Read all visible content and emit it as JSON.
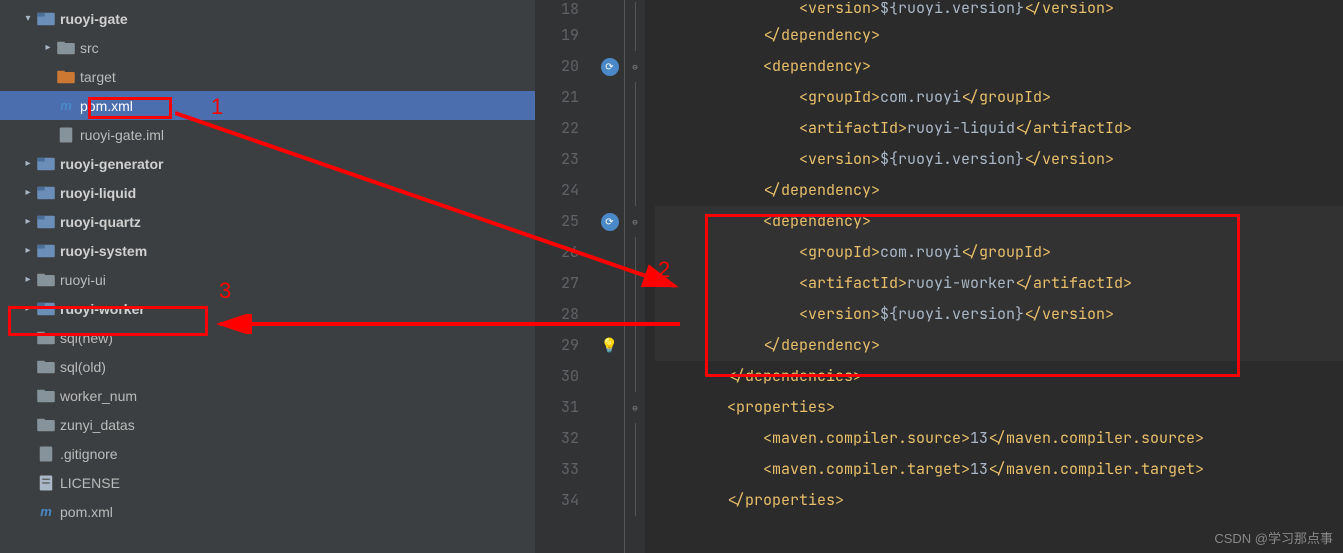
{
  "tree": {
    "items": [
      {
        "indent": 1,
        "arrow": "v",
        "icon": "module",
        "label": "ruoyi-gate",
        "bold": true
      },
      {
        "indent": 2,
        "arrow": ">",
        "icon": "folder",
        "label": "src"
      },
      {
        "indent": 2,
        "arrow": "",
        "icon": "folder-orange",
        "label": "target"
      },
      {
        "indent": 2,
        "arrow": "",
        "icon": "maven",
        "label": "pom.xml",
        "selected": true
      },
      {
        "indent": 2,
        "arrow": "",
        "icon": "file",
        "label": "ruoyi-gate.iml"
      },
      {
        "indent": 1,
        "arrow": ">",
        "icon": "module",
        "label": "ruoyi-generator",
        "bold": true
      },
      {
        "indent": 1,
        "arrow": ">",
        "icon": "module",
        "label": "ruoyi-liquid",
        "bold": true
      },
      {
        "indent": 1,
        "arrow": ">",
        "icon": "module",
        "label": "ruoyi-quartz",
        "bold": true
      },
      {
        "indent": 1,
        "arrow": ">",
        "icon": "module",
        "label": "ruoyi-system",
        "bold": true
      },
      {
        "indent": 1,
        "arrow": ">",
        "icon": "folder",
        "label": "ruoyi-ui"
      },
      {
        "indent": 1,
        "arrow": ">",
        "icon": "module",
        "label": "ruoyi-worker",
        "bold": true
      },
      {
        "indent": 1,
        "arrow": "",
        "icon": "folder",
        "label": "sql(new)"
      },
      {
        "indent": 1,
        "arrow": "",
        "icon": "folder",
        "label": "sql(old)"
      },
      {
        "indent": 1,
        "arrow": "",
        "icon": "folder",
        "label": "worker_num"
      },
      {
        "indent": 1,
        "arrow": "",
        "icon": "folder",
        "label": "zunyi_datas"
      },
      {
        "indent": 1,
        "arrow": "",
        "icon": "file",
        "label": ".gitignore"
      },
      {
        "indent": 1,
        "arrow": "",
        "icon": "file-text",
        "label": "LICENSE"
      },
      {
        "indent": 1,
        "arrow": "",
        "icon": "maven",
        "label": "pom.xml"
      }
    ]
  },
  "editor": {
    "lines": [
      {
        "num": "18",
        "ind": 4,
        "t": "closetag",
        "content": "version",
        "suffix": ">${ruoyi.version}</version>"
      },
      {
        "num": "19",
        "ind": 3,
        "t": "closetag",
        "content": "dependency"
      },
      {
        "num": "20",
        "ind": 3,
        "t": "opentag",
        "content": "dependency",
        "marker": "badge"
      },
      {
        "num": "21",
        "ind": 4,
        "t": "elem",
        "content": "groupId",
        "value": "com.ruoyi"
      },
      {
        "num": "22",
        "ind": 4,
        "t": "elem",
        "content": "artifactId",
        "value": "ruoyi-liquid"
      },
      {
        "num": "23",
        "ind": 4,
        "t": "elem",
        "content": "version",
        "value": "${ruoyi.version}"
      },
      {
        "num": "24",
        "ind": 3,
        "t": "closetag",
        "content": "dependency"
      },
      {
        "num": "25",
        "ind": 3,
        "t": "opentag",
        "content": "dependency",
        "marker": "badge",
        "hl": true
      },
      {
        "num": "26",
        "ind": 4,
        "t": "elem",
        "content": "groupId",
        "value": "com.ruoyi",
        "hl": true
      },
      {
        "num": "27",
        "ind": 4,
        "t": "elem",
        "content": "artifactId",
        "value": "ruoyi-worker",
        "hl": true
      },
      {
        "num": "28",
        "ind": 4,
        "t": "elem",
        "content": "version",
        "value": "${ruoyi.version}",
        "hl": true
      },
      {
        "num": "29",
        "ind": 3,
        "t": "closetag",
        "content": "dependency",
        "marker": "bulb",
        "hl": true
      },
      {
        "num": "30",
        "ind": 2,
        "t": "closetag",
        "content": "dependencies"
      },
      {
        "num": "31",
        "ind": 2,
        "t": "opentag",
        "content": "properties"
      },
      {
        "num": "32",
        "ind": 3,
        "t": "elem",
        "content": "maven.compiler.source",
        "value": "13"
      },
      {
        "num": "33",
        "ind": 3,
        "t": "elem",
        "content": "maven.compiler.target",
        "value": "13"
      },
      {
        "num": "34",
        "ind": 2,
        "t": "closetag",
        "content": "properties"
      }
    ],
    "first_line_text": "<version>${ruoyi.version}</version>"
  },
  "annotations": {
    "num1": "1",
    "num2": "2",
    "num3": "3"
  },
  "watermark": "CSDN @学习那点事"
}
